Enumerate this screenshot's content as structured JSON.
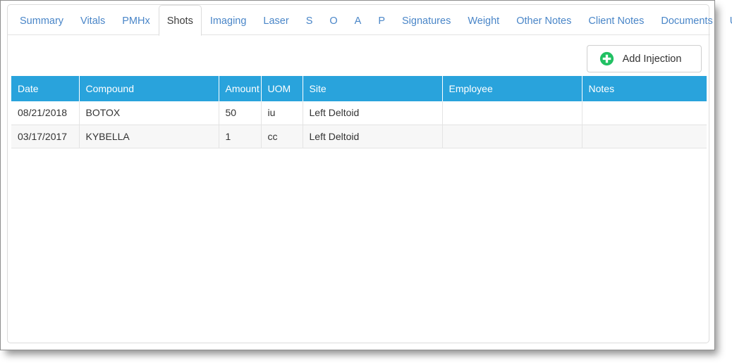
{
  "colors": {
    "header_blue": "#29A3DC",
    "tab_link_blue": "#4A86C8",
    "plus_green": "#21C063",
    "row_alt_gray": "#F7F7F7",
    "border_gray": "#E4E4E4"
  },
  "tabs": [
    {
      "label": "Summary",
      "active": false
    },
    {
      "label": "Vitals",
      "active": false
    },
    {
      "label": "PMHx",
      "active": false
    },
    {
      "label": "Shots",
      "active": true
    },
    {
      "label": "Imaging",
      "active": false
    },
    {
      "label": "Laser",
      "active": false
    },
    {
      "label": "S",
      "active": false
    },
    {
      "label": "O",
      "active": false
    },
    {
      "label": "A",
      "active": false
    },
    {
      "label": "P",
      "active": false
    },
    {
      "label": "Signatures",
      "active": false
    },
    {
      "label": "Weight",
      "active": false
    },
    {
      "label": "Other Notes",
      "active": false
    },
    {
      "label": "Client Notes",
      "active": false
    },
    {
      "label": "Documents",
      "active": false
    },
    {
      "label": "UMR Forms",
      "active": false
    }
  ],
  "toolbar": {
    "add_injection_label": "Add Injection",
    "add_injection_icon": "plus-circle-icon"
  },
  "table": {
    "columns": [
      "Date",
      "Compound",
      "Amount",
      "UOM",
      "Site",
      "Employee",
      "Notes"
    ],
    "rows": [
      {
        "date": "08/21/2018",
        "compound": "BOTOX",
        "amount": "50",
        "uom": "iu",
        "site": "Left Deltoid",
        "employee": "",
        "notes": ""
      },
      {
        "date": "03/17/2017",
        "compound": "KYBELLA",
        "amount": "1",
        "uom": "cc",
        "site": "Left Deltoid",
        "employee": "",
        "notes": ""
      }
    ]
  }
}
